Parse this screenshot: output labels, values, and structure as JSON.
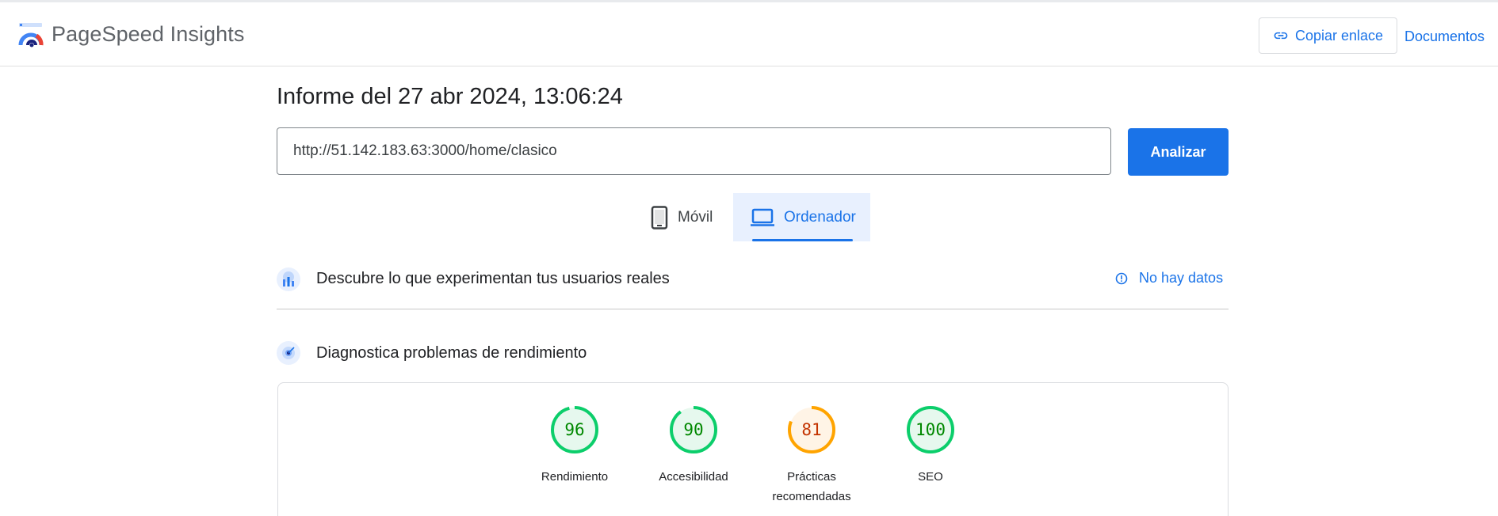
{
  "app": {
    "title": "PageSpeed Insights"
  },
  "header": {
    "copy_link_label": "Copiar enlace",
    "docs_label": "Documentos"
  },
  "report": {
    "title": "Informe del 27 abr 2024, 13:06:24"
  },
  "search": {
    "url_value": "http://51.142.183.63:3000/home/clasico",
    "analyze_label": "Analizar"
  },
  "device_tabs": [
    {
      "label": "Móvil",
      "icon": "phone-icon",
      "selected": false
    },
    {
      "label": "Ordenador",
      "icon": "laptop-icon",
      "selected": true
    }
  ],
  "sections": {
    "crux": {
      "title": "Descubre lo que experimentan tus usuarios reales",
      "status_label": "No hay datos"
    },
    "diagnostics": {
      "title": "Diagnostica problemas de rendimiento"
    }
  },
  "scores": [
    {
      "label": "Rendimiento",
      "value": "96",
      "status": "good"
    },
    {
      "label": "Accesibilidad",
      "value": "90",
      "status": "good"
    },
    {
      "label": "Prácticas recomendadas",
      "value": "81",
      "status": "average"
    },
    {
      "label": "SEO",
      "value": "100",
      "status": "good"
    }
  ],
  "colors": {
    "accent": "#1a73e8",
    "good_stroke": "#0cce6b",
    "good_fill": "#e6f8ee",
    "good_text": "#008800",
    "average_stroke": "#ffa400",
    "average_fill": "#fff4e6",
    "average_text": "#c33300"
  }
}
